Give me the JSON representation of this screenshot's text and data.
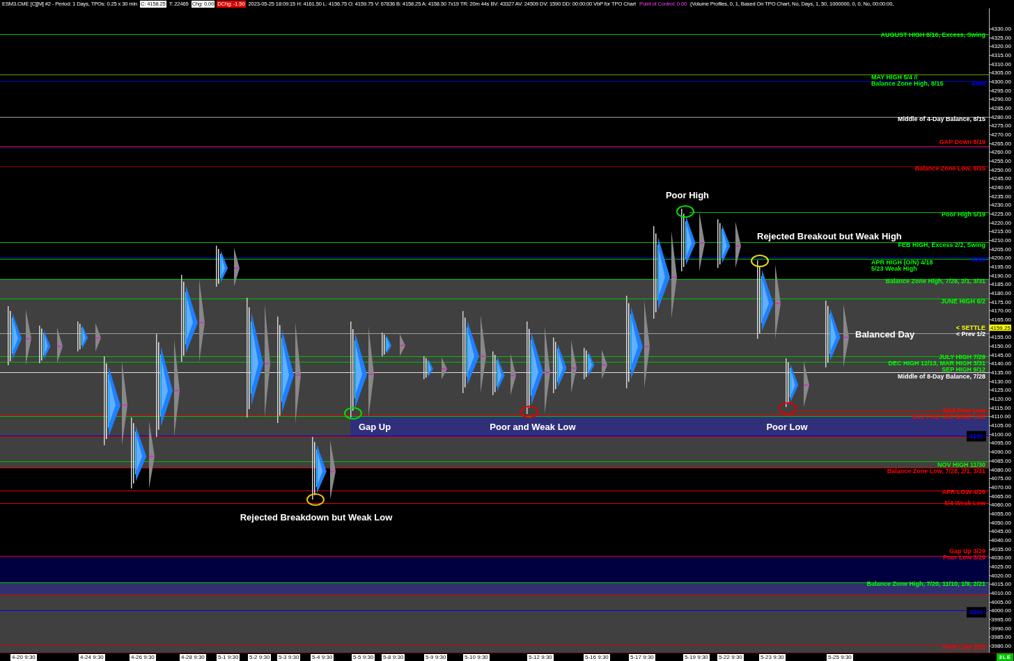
{
  "header": [
    {
      "kind": "plain",
      "text": "ESM3.CME [C][M]  #2 - Period: 1 Days, TPOs: 0.25 x 30 min"
    },
    {
      "kind": "inverse",
      "text": "C: 4158.25"
    },
    {
      "kind": "plain",
      "text": "T: 22465"
    },
    {
      "kind": "inverse",
      "text": "Chg: 0.00"
    },
    {
      "kind": "alert",
      "text": "DChg: -1.50"
    },
    {
      "kind": "plain",
      "text": "2023-05-25 18:09:15 H: 4161.50 L: 4156.75 O: 4159.75 V: 67836 B: 4158.25 A: 4158.50 7x19 TR: 20m 44s BV: 43327 AV: 24509 DV: 1590 DD: 00:00:00 VbP for TPO Chart"
    },
    {
      "kind": "highlight",
      "text": "Point of Control: 0.00"
    },
    {
      "kind": "plain",
      "text": "(Volume Profiles, 0, 1, Based On TPO Chart, No, Days, 1, 50, 1000000, 0, 0, No, 00:00:00,"
    }
  ],
  "chart": {
    "labels": [
      {
        "text": "AUGUST HIGH 8/16, Excess, Swing",
        "color": "#00ff00"
      },
      {
        "text": "MAY HIGH 5/4 //",
        "color": "#00ff00"
      },
      {
        "text": "Balance Zone High, 8/15",
        "color": "#00ff00"
      },
      {
        "text": "4300",
        "color": "#0000ff"
      },
      {
        "text": "Middle of 4-Day Balance, 8/15",
        "color": "#ffffff"
      },
      {
        "text": "GAP Down 8/19",
        "color": "#ff0000"
      },
      {
        "text": "Balance Zone Low, 8/15",
        "color": "#ff0000"
      },
      {
        "text": "Poor High 5/19",
        "color": "#00ff00"
      },
      {
        "text": "FEB HIGH, Excess 2/2, Swing",
        "color": "#00ff00"
      },
      {
        "text": "4200",
        "color": "#0000ff"
      },
      {
        "text": "APR HIGH (O/N) 4/18",
        "color": "#00ff00"
      },
      {
        "text": "5/23 Weak High",
        "color": "#00ff00"
      },
      {
        "text": "Balance Zone High, 7/28, 2/1, 3/31",
        "color": "#00ff00"
      },
      {
        "text": "JUNE HIGH 6/2",
        "color": "#00ff00"
      },
      {
        "text": "< SETTLE",
        "color": "#ffff00"
      },
      {
        "text": "< Prev 1/2",
        "color": "#ffffff"
      },
      {
        "text": "JULY HIGH 7/29",
        "color": "#00ff00"
      },
      {
        "text": "DEC HIGH 12/13, MAR HIGH 3/31",
        "color": "#00ff00"
      },
      {
        "text": "SEP HIGH 9/12",
        "color": "#00ff00"
      },
      {
        "text": "Middle of 8-Day Balance, 7/28",
        "color": "#ffffff"
      },
      {
        "text": "5/24 Poor Low",
        "color": "#ff0000"
      },
      {
        "text": "5/12 Poor and Weak Low",
        "color": "#ff0000"
      },
      {
        "text": "4100",
        "color": "#0000ff"
      },
      {
        "text": "NOV HIGH 11/30",
        "color": "#00ff00"
      },
      {
        "text": "Balance Zone Low, 7/28, 2/1, 3/31",
        "color": "#ff0000"
      },
      {
        "text": "APR LOW 4/26",
        "color": "#ff0000"
      },
      {
        "text": "5/4 Weak Low",
        "color": "#ff0000"
      },
      {
        "text": "Gap Up 3/29",
        "color": "#ff0000"
      },
      {
        "text": "Poor Low 3/29",
        "color": "#ff0000"
      },
      {
        "text": "Balance Zone High, 7/20, 11/10, 1/9, 2/21",
        "color": "#00ff00"
      },
      {
        "text": "4000",
        "color": "#0000ff"
      },
      {
        "text": "Poor Low 3/20",
        "color": "#ff0000"
      }
    ],
    "annotations": [
      "Poor High",
      "Rejected Breakout but Weak High",
      "Balanced Day",
      "Gap Up",
      "Poor and Weak Low",
      "Poor Low",
      "Rejected Breakdown but Weak Low"
    ],
    "circles": [
      {
        "color": "#00e000"
      },
      {
        "color": "#f0e000"
      },
      {
        "color": "#00e000"
      },
      {
        "color": "#e00000"
      },
      {
        "color": "#e00000"
      },
      {
        "color": "#f0c000"
      }
    ],
    "last_price": "4159.25"
  },
  "price_axis": {
    "ticks": [
      "4330.00",
      "4325.00",
      "4320.00",
      "4315.00",
      "4310.00",
      "4305.00",
      "4300.00",
      "4295.00",
      "4290.00",
      "4285.00",
      "4280.00",
      "4275.00",
      "4270.00",
      "4265.00",
      "4260.00",
      "4255.00",
      "4250.00",
      "4245.00",
      "4240.00",
      "4235.00",
      "4230.00",
      "4225.00",
      "4220.00",
      "4215.00",
      "4210.00",
      "4205.00",
      "4200.00",
      "4195.00",
      "4190.00",
      "4185.00",
      "4180.00",
      "4175.00",
      "4170.00",
      "4165.00",
      "4155.00",
      "4150.00",
      "4145.00",
      "4140.00",
      "4135.00",
      "4130.00",
      "4125.00",
      "4120.00",
      "4115.00",
      "4110.00",
      "4105.00",
      "4100.00",
      "4095.00",
      "4090.00",
      "4085.00",
      "4080.00",
      "4075.00",
      "4070.00",
      "4065.00",
      "4060.00",
      "4055.00",
      "4050.00",
      "4045.00",
      "4040.00",
      "4035.00",
      "4030.00",
      "4025.00",
      "4020.00",
      "4015.00",
      "4010.00",
      "4005.00",
      "4000.00",
      "3995.00",
      "3990.00",
      "3985.00",
      "3980.00"
    ]
  },
  "time_axis": [
    "4-20 9:30",
    "4-24 9:30",
    "4-26 9:30",
    "4-28 9:30",
    "5-1 9:30",
    "5-2 9:30",
    "5-3 9:30",
    "5-4 9:30",
    "5-5 9:30",
    "5-8 9:30",
    "5-9 9:30",
    "5-10 9:30",
    "5-12 9:30",
    "5-16 9:30",
    "5-17 9:30",
    "5-19 9:30",
    "5-22 9:30",
    "5-23 9:30",
    "5-25 9:30"
  ],
  "badge": "3LE"
}
